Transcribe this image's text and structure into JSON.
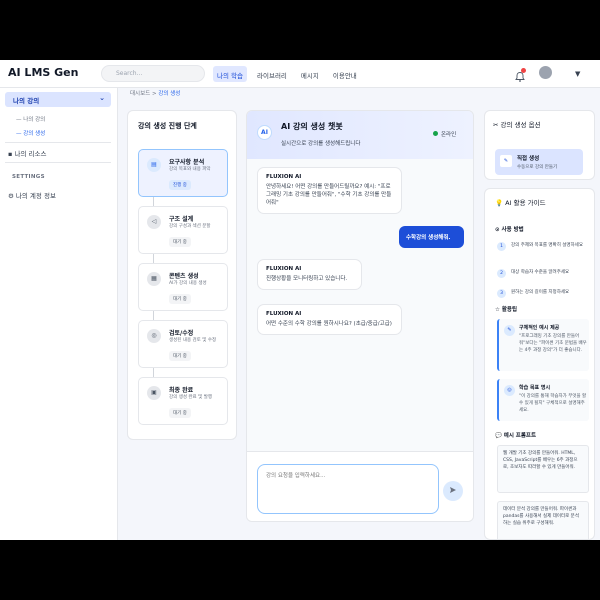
{
  "header": {
    "logo": "AI LMS Gen",
    "search_placeholder": "Search...",
    "nav": [
      "나의 학습",
      "라이브러리",
      "메시지",
      "이용안내"
    ]
  },
  "sidebar": {
    "main": "나의 강의",
    "subs": [
      "나의 강의",
      "강의 생성"
    ],
    "resources": "나의 리소스",
    "settings_section": "SETTINGS",
    "account": "나의 계정 정보"
  },
  "breadcrumb": {
    "root": "대시보드",
    "sep": ">",
    "current": "강의 생성"
  },
  "progress": {
    "title": "강의 생성 진행 단계",
    "steps": [
      {
        "title": "요구사항 분석",
        "desc": "강의 목표와 내용 파악",
        "status": "진행 중",
        "icon": "clipboard-icon"
      },
      {
        "title": "구조 설계",
        "desc": "강의 구성과 섹션 분할",
        "status": "대기 중",
        "icon": "structure-icon"
      },
      {
        "title": "콘텐츠 생성",
        "desc": "AI가 강의 내용 생성",
        "status": "대기 중",
        "icon": "content-icon"
      },
      {
        "title": "검토/수정",
        "desc": "생성된 내용 검토 및 수정",
        "status": "대기 중",
        "icon": "review-icon"
      },
      {
        "title": "최종 완료",
        "desc": "강의 생성 완료 및 발행",
        "status": "대기 중",
        "icon": "done-icon"
      }
    ]
  },
  "chat": {
    "title": "AI 강의 생성 챗봇",
    "subtitle": "실시간으로 강의를 생성해드립니다",
    "status": "온라인",
    "ai_icon": "AI",
    "messages": [
      {
        "sender": "FLUXION AI",
        "text": "안녕하세요! 어떤 강의를 만들어드릴까요? 예시: \"프로그래밍 기초 강의를 만들어줘\", \"수학 기초 강의를 만들어줘\""
      },
      {
        "sender": "user",
        "text": "수학강의 생성해줘."
      },
      {
        "sender": "FLUXION AI",
        "text": "진행상황을 모니터링하고 있습니다."
      },
      {
        "sender": "FLUXION AI",
        "text": "어떤 수준의 수학 강의를 원하시나요? (초급/중급/고급)"
      }
    ],
    "input_placeholder": "강의 요청을 입력하세요...",
    "send_icon": "send-icon"
  },
  "options": {
    "title": "강의 생성 옵션",
    "card_title": "직접 생성",
    "card_desc": "수동으로 강의 만들기",
    "card_icon": "edit-icon"
  },
  "guide": {
    "title": "AI 활용 가이드",
    "usage_header": "사용 방법",
    "usage_steps": [
      "강의 주제와 목표를 명확히 설명하세요",
      "대상 학습자 수준을 알려주세요",
      "원하는 강의 길이를 지정하세요"
    ],
    "tips_header": "활용팁",
    "tips": [
      {
        "title": "구체적인 예시 제공",
        "text": "\"프로그래밍 기초 강의를 만들어줘\"보다는 \"파이썬 기초 문법을 배우는 4주 과정 강의\"가 더 좋습니다."
      },
      {
        "title": "학습 목표 명시",
        "text": "\"이 강의를 통해 학습자가 무엇을 할 수 있게 될지\" 구체적으로 설명해주세요."
      }
    ],
    "prompts_header": "예시 프롬프트",
    "prompts": [
      "웹 개발 기초 강의를 만들어줘. HTML, CSS, JavaScript를 배우는 6주 과정으로, 초보자도 따라할 수 있게 만들어줘.",
      "데이터 분석 강의를 만들어줘. 파이썬과 pandas를 사용해서 실제 데이터로 분석하는 실습 위주로 구성해줘."
    ]
  }
}
